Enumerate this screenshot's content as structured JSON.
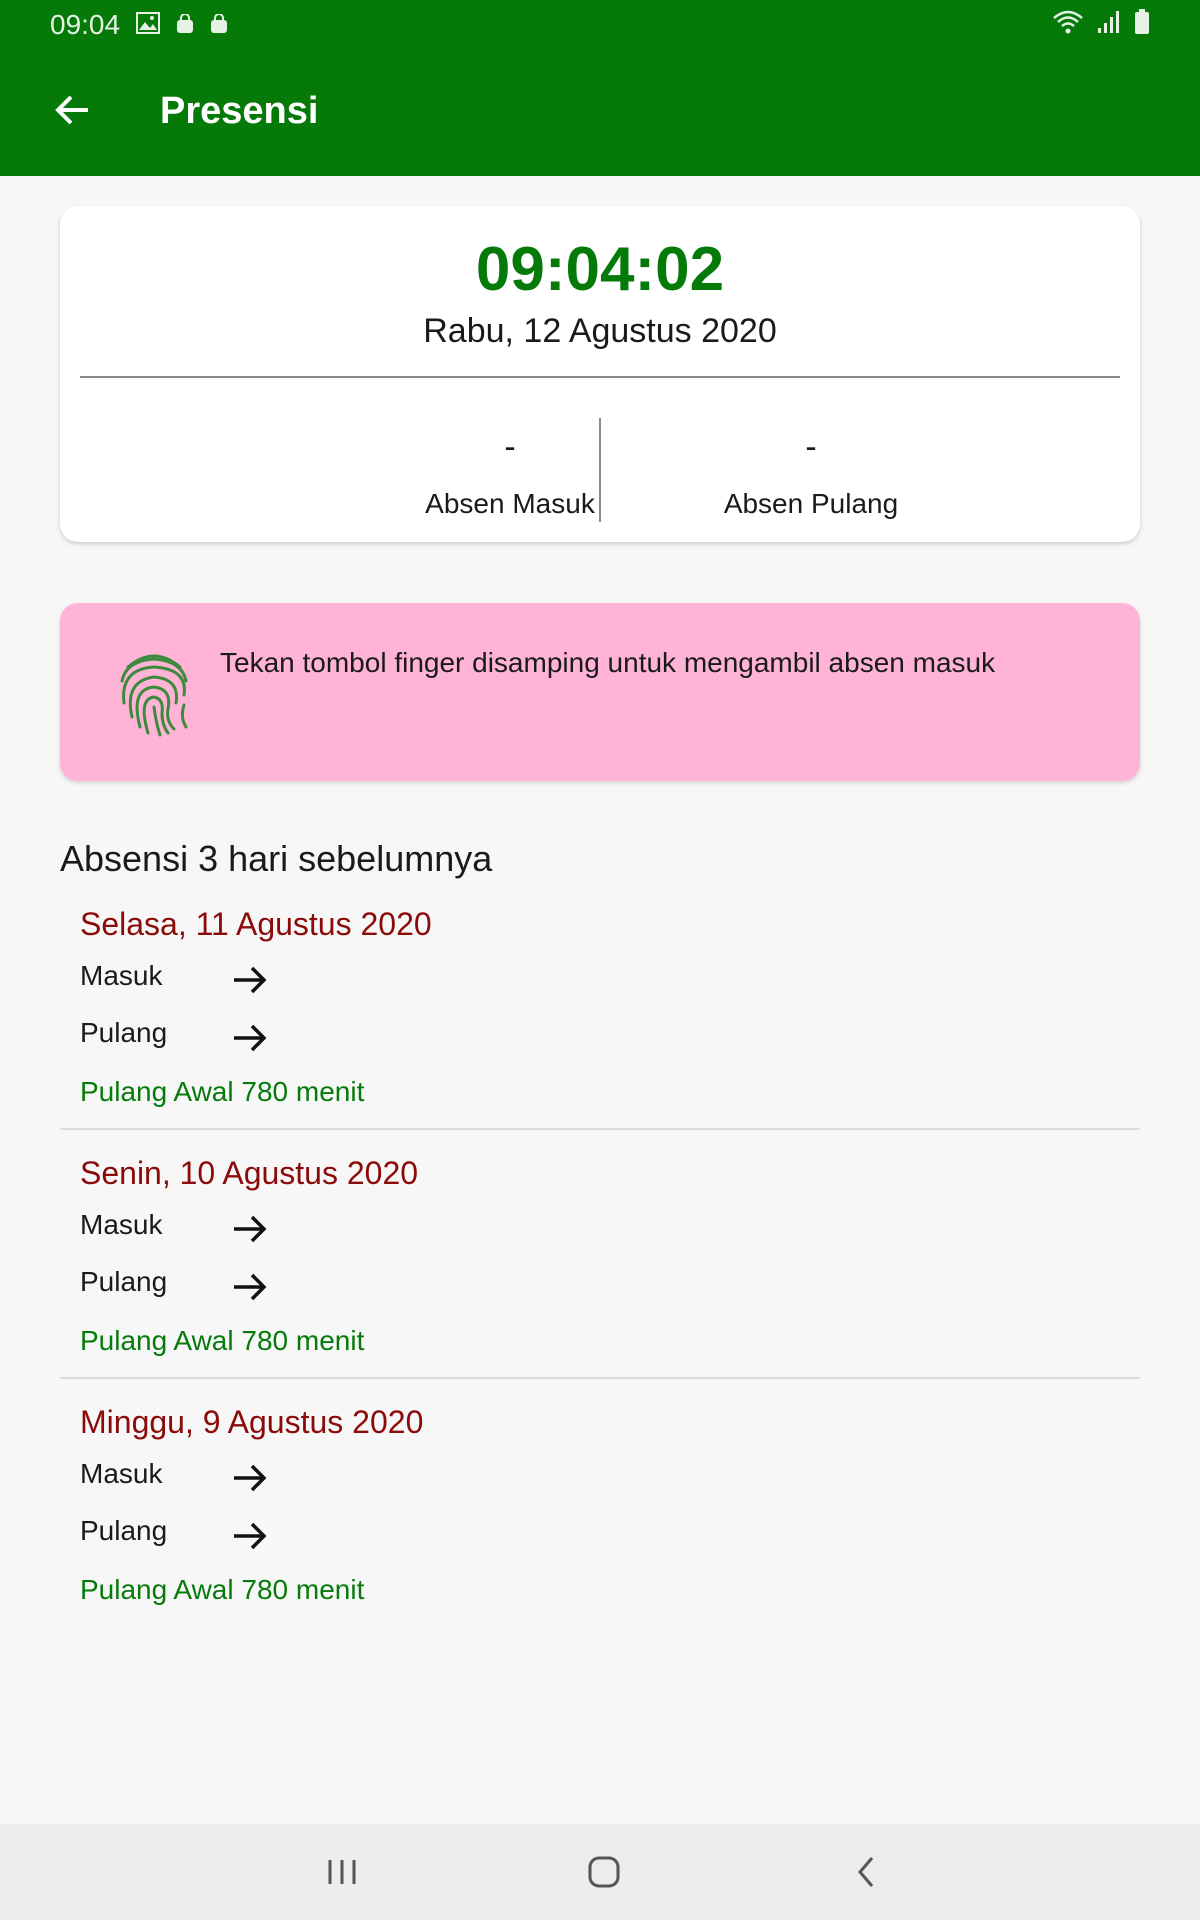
{
  "status_bar": {
    "time": "09:04",
    "left_icons": [
      "image-icon",
      "bag-icon",
      "bag-icon"
    ],
    "right_icons": [
      "wifi-icon",
      "signal-icon",
      "battery-icon"
    ]
  },
  "app_bar": {
    "title": "Presensi",
    "back_icon": "arrow-left-icon",
    "color": "#057a08"
  },
  "clock_card": {
    "time": "09:04:02",
    "date": "Rabu, 12 Agustus 2020",
    "absen_masuk": {
      "value": "-",
      "label": "Absen Masuk"
    },
    "absen_pulang": {
      "value": "-",
      "label": "Absen Pulang"
    }
  },
  "finger_banner": {
    "icon": "fingerprint-icon",
    "text": "Tekan tombol finger disamping untuk mengambil absen masuk",
    "background": "#ffb3d6"
  },
  "history": {
    "title": "Absensi 3 hari sebelumnya",
    "days": [
      {
        "date": "Selasa, 11 Agustus 2020",
        "masuk_label": "Masuk",
        "pulang_label": "Pulang",
        "note": "Pulang Awal 780 menit"
      },
      {
        "date": "Senin, 10 Agustus 2020",
        "masuk_label": "Masuk",
        "pulang_label": "Pulang",
        "note": "Pulang Awal 780 menit"
      },
      {
        "date": "Minggu, 9 Agustus 2020",
        "masuk_label": "Masuk",
        "pulang_label": "Pulang",
        "note": "Pulang Awal 780 menit"
      }
    ]
  },
  "nav_bar": {
    "buttons": [
      "recent-apps-icon",
      "home-icon",
      "back-icon"
    ]
  }
}
